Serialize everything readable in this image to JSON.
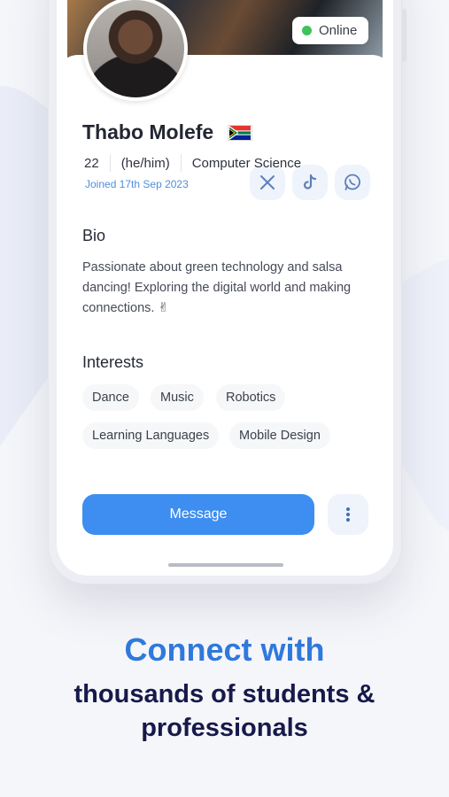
{
  "profile": {
    "status": "Online",
    "name": "Thabo Molefe",
    "age": "22",
    "pronouns": "(he/him)",
    "field": "Computer Science",
    "joined": "Joined 17th Sep 2023",
    "flag_icon": "south-africa-flag-icon"
  },
  "social_icons": [
    "x-icon",
    "tiktok-icon",
    "whatsapp-icon"
  ],
  "bio": {
    "title": "Bio",
    "text": "Passionate about green technology and salsa dancing! Exploring the digital world and making connections. ✌"
  },
  "interests": {
    "title": "Interests",
    "items": [
      "Dance",
      "Music",
      "Robotics",
      "Learning Languages",
      "Mobile Design"
    ]
  },
  "actions": {
    "message_label": "Message",
    "more_icon": "more-vertical-icon"
  },
  "promo": {
    "headline": "Connect with",
    "subline_1": "thousands of students &",
    "subline_2": "professionals"
  },
  "colors": {
    "accent": "#3d8ef0",
    "online": "#3fc25a",
    "headline": "#2f79dc",
    "subline": "#17194a"
  }
}
